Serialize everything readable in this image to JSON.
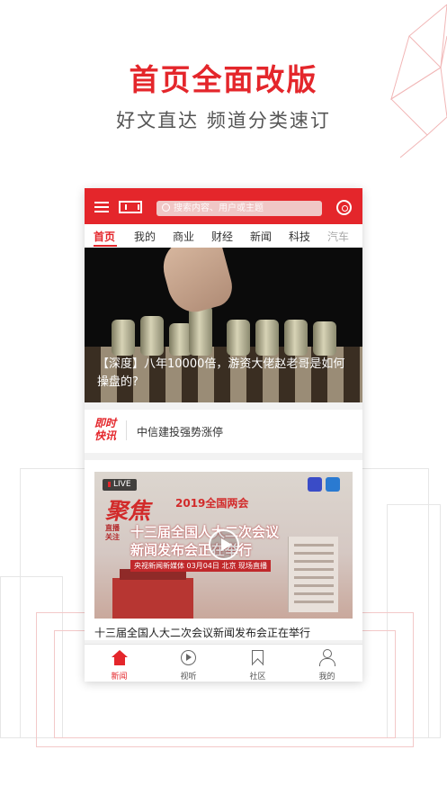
{
  "promo": {
    "title": "首页全面改版",
    "subtitle": "好文直达 频道分类速订"
  },
  "app": {
    "search": {
      "placeholder": "搜索内容、用户或主题"
    },
    "tabs": [
      {
        "label": "首页",
        "active": true
      },
      {
        "label": "我的"
      },
      {
        "label": "商业"
      },
      {
        "label": "财经"
      },
      {
        "label": "新闻"
      },
      {
        "label": "科技"
      },
      {
        "label": "汽车"
      }
    ],
    "hero": {
      "title": "【深度】八年10000倍，游资大佬赵老哥是如何操盘的?"
    },
    "flash": {
      "logo_line1": "即时",
      "logo_line2": "快讯",
      "text": "中信建投强势涨停"
    },
    "video": {
      "live": "LIVE",
      "headline": "聚焦",
      "year_tag": "2019全国两会",
      "focus_tag": "直播关注",
      "overlay_line1": "十三届全国人大二次会议",
      "overlay_line2": "新闻发布会正在举行",
      "info": "央视新闻新媒体 03月04日 北京 现场直播",
      "title": "十三届全国人大二次会议新闻发布会正在举行"
    },
    "bottom_nav": [
      {
        "label": "新闻",
        "icon": "home-icon",
        "active": true
      },
      {
        "label": "视听",
        "icon": "play-circle-icon"
      },
      {
        "label": "社区",
        "icon": "bookmark-icon"
      },
      {
        "label": "我的",
        "icon": "user-icon"
      }
    ],
    "colors": {
      "brand": "#e4262b"
    }
  }
}
